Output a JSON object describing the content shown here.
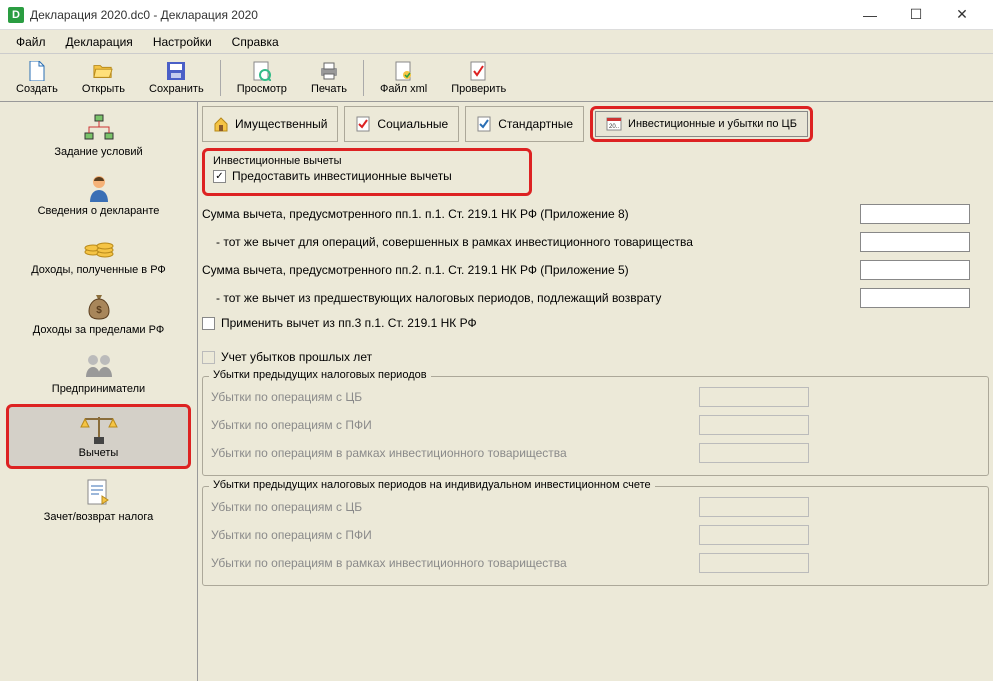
{
  "window": {
    "title": "Декларация 2020.dc0 - Декларация 2020",
    "icon_letter": "D"
  },
  "menubar": [
    "Файл",
    "Декларация",
    "Настройки",
    "Справка"
  ],
  "toolbar": [
    {
      "id": "create",
      "label": "Создать"
    },
    {
      "id": "open",
      "label": "Открыть"
    },
    {
      "id": "save",
      "label": "Сохранить"
    },
    {
      "id": "preview",
      "label": "Просмотр"
    },
    {
      "id": "print",
      "label": "Печать"
    },
    {
      "id": "xml",
      "label": "Файл xml"
    },
    {
      "id": "check",
      "label": "Проверить"
    }
  ],
  "sidebar": [
    {
      "id": "conditions",
      "label": "Задание условий"
    },
    {
      "id": "declarant",
      "label": "Сведения о декларанте"
    },
    {
      "id": "income-rf",
      "label": "Доходы, полученные в РФ"
    },
    {
      "id": "income-foreign",
      "label": "Доходы за пределами РФ"
    },
    {
      "id": "entrepreneurs",
      "label": "Предприниматели"
    },
    {
      "id": "deductions",
      "label": "Вычеты",
      "selected": true
    },
    {
      "id": "offset-refund",
      "label": "Зачет/возврат налога"
    }
  ],
  "tabs": [
    {
      "id": "property",
      "label": "Имущественный"
    },
    {
      "id": "social",
      "label": "Социальные"
    },
    {
      "id": "standard",
      "label": "Стандартные"
    },
    {
      "id": "invest",
      "label": "Инвестиционные и убытки по ЦБ",
      "active": true
    }
  ],
  "invest": {
    "group_title": "Инвестиционные вычеты",
    "checkbox_provide": "Предоставить инвестиционные вычеты",
    "row1": "Сумма вычета, предусмотренного пп.1. п.1. Ст. 219.1 НК РФ (Приложение 8)",
    "row1a": " - тот же вычет для операций, совершенных в рамках инвестиционного товарищества",
    "row2": "Сумма вычета, предусмотренного пп.2. п.1. Ст. 219.1 НК РФ (Приложение 5)",
    "row2a": " - тот же вычет из предшествующих налоговых периодов, подлежащий возврату",
    "row3_chk": "Применить вычет из пп.3 п.1. Ст. 219.1 НК РФ"
  },
  "losses": {
    "chk_label": "Учет убытков прошлых лет",
    "group1_title": "Убытки предыдущих налоговых периодов",
    "group2_title": "Убытки предыдущих налоговых периодов на индивидуальном инвестиционном счете",
    "row_cb": "Убытки по операциям с ЦБ",
    "row_pfi": "Убытки по операциям с ПФИ",
    "row_it": "Убытки по операциям в рамках инвестиционного товарищества"
  }
}
